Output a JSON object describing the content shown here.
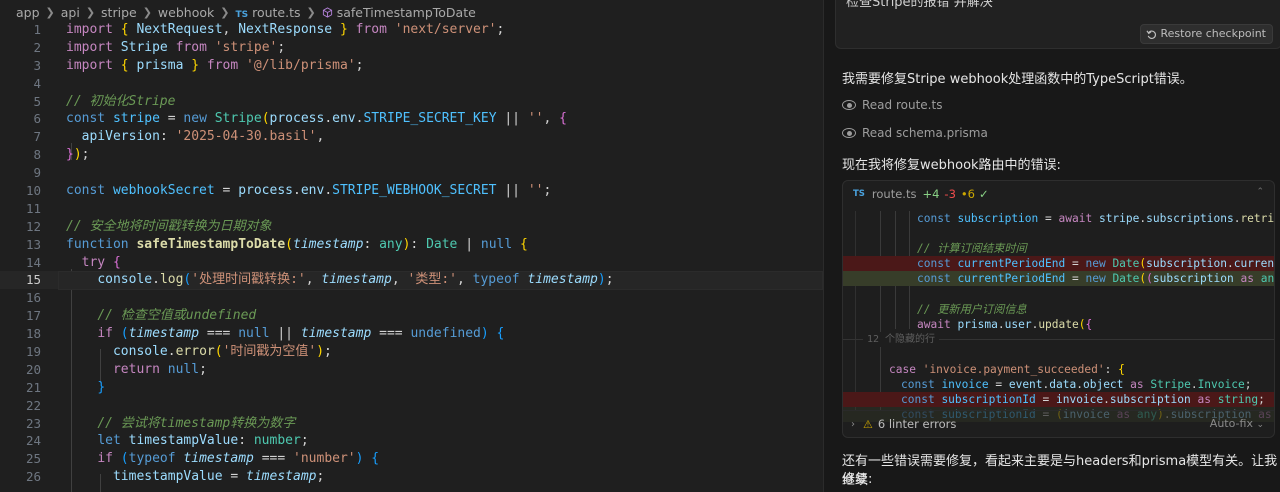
{
  "breadcrumb": {
    "segments": [
      "app",
      "api",
      "stripe",
      "webhook"
    ],
    "file": "route.ts",
    "file_badge": "TS",
    "symbol": "safeTimestampToDate"
  },
  "editor": {
    "current_line": 15,
    "line_numbers": [
      "1",
      "2",
      "3",
      "4",
      "5",
      "6",
      "7",
      "8",
      "9",
      "10",
      "11",
      "12",
      "13",
      "14",
      "15",
      "16",
      "17",
      "18",
      "19",
      "20",
      "21",
      "22",
      "23",
      "24",
      "25",
      "26"
    ],
    "comments": {
      "init_stripe": "// 初始化Stripe",
      "safe_convert": "// 安全地将时间戳转换为日期对象",
      "check_null": "// 检查空值或undefined",
      "try_convert": "// 尝试将timestamp转换为数字"
    },
    "strings": {
      "next_server": "'next/server'",
      "stripe": "'stripe'",
      "lib_prisma": "'@/lib/prisma'",
      "empty": "''",
      "api_version": "'2025-04-30.basil'",
      "processing": "'处理时间戳转换:'",
      "type_label": "'类型:'",
      "empty_ts": "'时间戳为空值'",
      "number": "'number'"
    }
  },
  "chat": {
    "top_cut_text": "检查Stripe的报错 并解决",
    "restore_checkpoint": "Restore checkpoint",
    "message_1": "我需要修复Stripe webhook处理函数中的TypeScript错误。",
    "tool_1": "Read route.ts",
    "tool_2": "Read schema.prisma",
    "message_2": "现在我将修复webhook路由中的错误:",
    "diff": {
      "badge": "TS",
      "filename": "route.ts",
      "added": "+4",
      "removed": "-3",
      "modified": "•6",
      "hidden_lines": "12 个隐藏的行",
      "comment_calc": "// 计算订阅结束时间",
      "comment_update": "// 更新用户订阅信息",
      "case_label": "'invoice.payment_succeeded'"
    },
    "linter_errors": "6 linter errors",
    "auto_fix": "Auto-fix",
    "message_3_line1": "还有一些错误需要修复，看起来主要是与headers和prisma模型有关。让我继续",
    "message_3_line2": "修复:"
  },
  "colors": {
    "editor_bg": "#1f1f1f",
    "chat_bg": "#181818",
    "keyword": "#569cd6",
    "control": "#c586c0",
    "string": "#ce9178",
    "comment": "#6a9955",
    "variable": "#9cdcfe",
    "type": "#4ec9b0",
    "function": "#dcdcaa",
    "diff_deleted": "#4b1818",
    "diff_inserted": "#373d29",
    "added": "#89d185",
    "removed": "#f14c4c",
    "warning": "#cca700"
  },
  "icons": [
    "chevron-right-icon",
    "typescript-file-icon",
    "symbol-cube-icon",
    "restore-icon",
    "eye-icon",
    "checkmark-icon",
    "warning-icon",
    "chevron-down-icon"
  ]
}
